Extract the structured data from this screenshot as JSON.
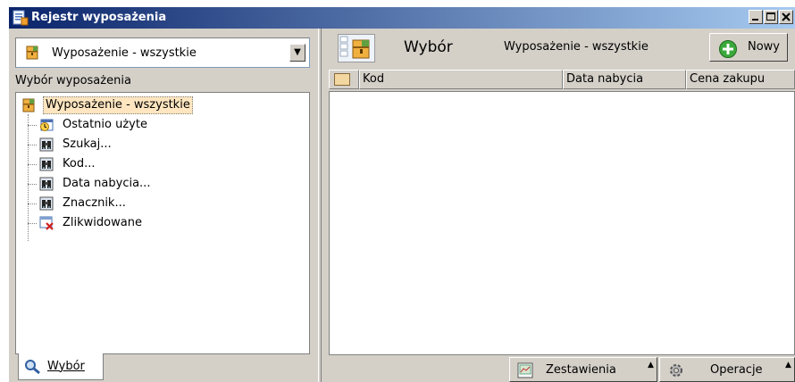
{
  "window": {
    "title": "Rejestr wyposażenia"
  },
  "left": {
    "combo_value": "Wyposażenie - wszystkie",
    "tree_caption": "Wybór wyposażenia",
    "tree": {
      "root": "Wyposażenie - wszystkie",
      "children": [
        {
          "label": "Ostatnio użyte",
          "icon": "recent-icon"
        },
        {
          "label": "Szukaj...",
          "icon": "binoculars-icon"
        },
        {
          "label": "Kod...",
          "icon": "binoculars-icon"
        },
        {
          "label": "Data nabycia...",
          "icon": "binoculars-icon"
        },
        {
          "label": "Znacznik...",
          "icon": "binoculars-icon"
        },
        {
          "label": "Zlikwidowane",
          "icon": "deleted-icon"
        }
      ]
    },
    "tab_label": "Wybór"
  },
  "right": {
    "title": "Wybór",
    "subtitle": "Wyposażenie - wszystkie",
    "new_button": "Nowy",
    "columns": [
      "Kod",
      "Data nabycia",
      "Cena zakupu"
    ],
    "reports_button": "Zestawienia",
    "operations_button": "Operacje"
  },
  "colors": {
    "titlebar": "#0a246a",
    "selection": "#ffe6c0",
    "face": "#d4d0c8"
  }
}
